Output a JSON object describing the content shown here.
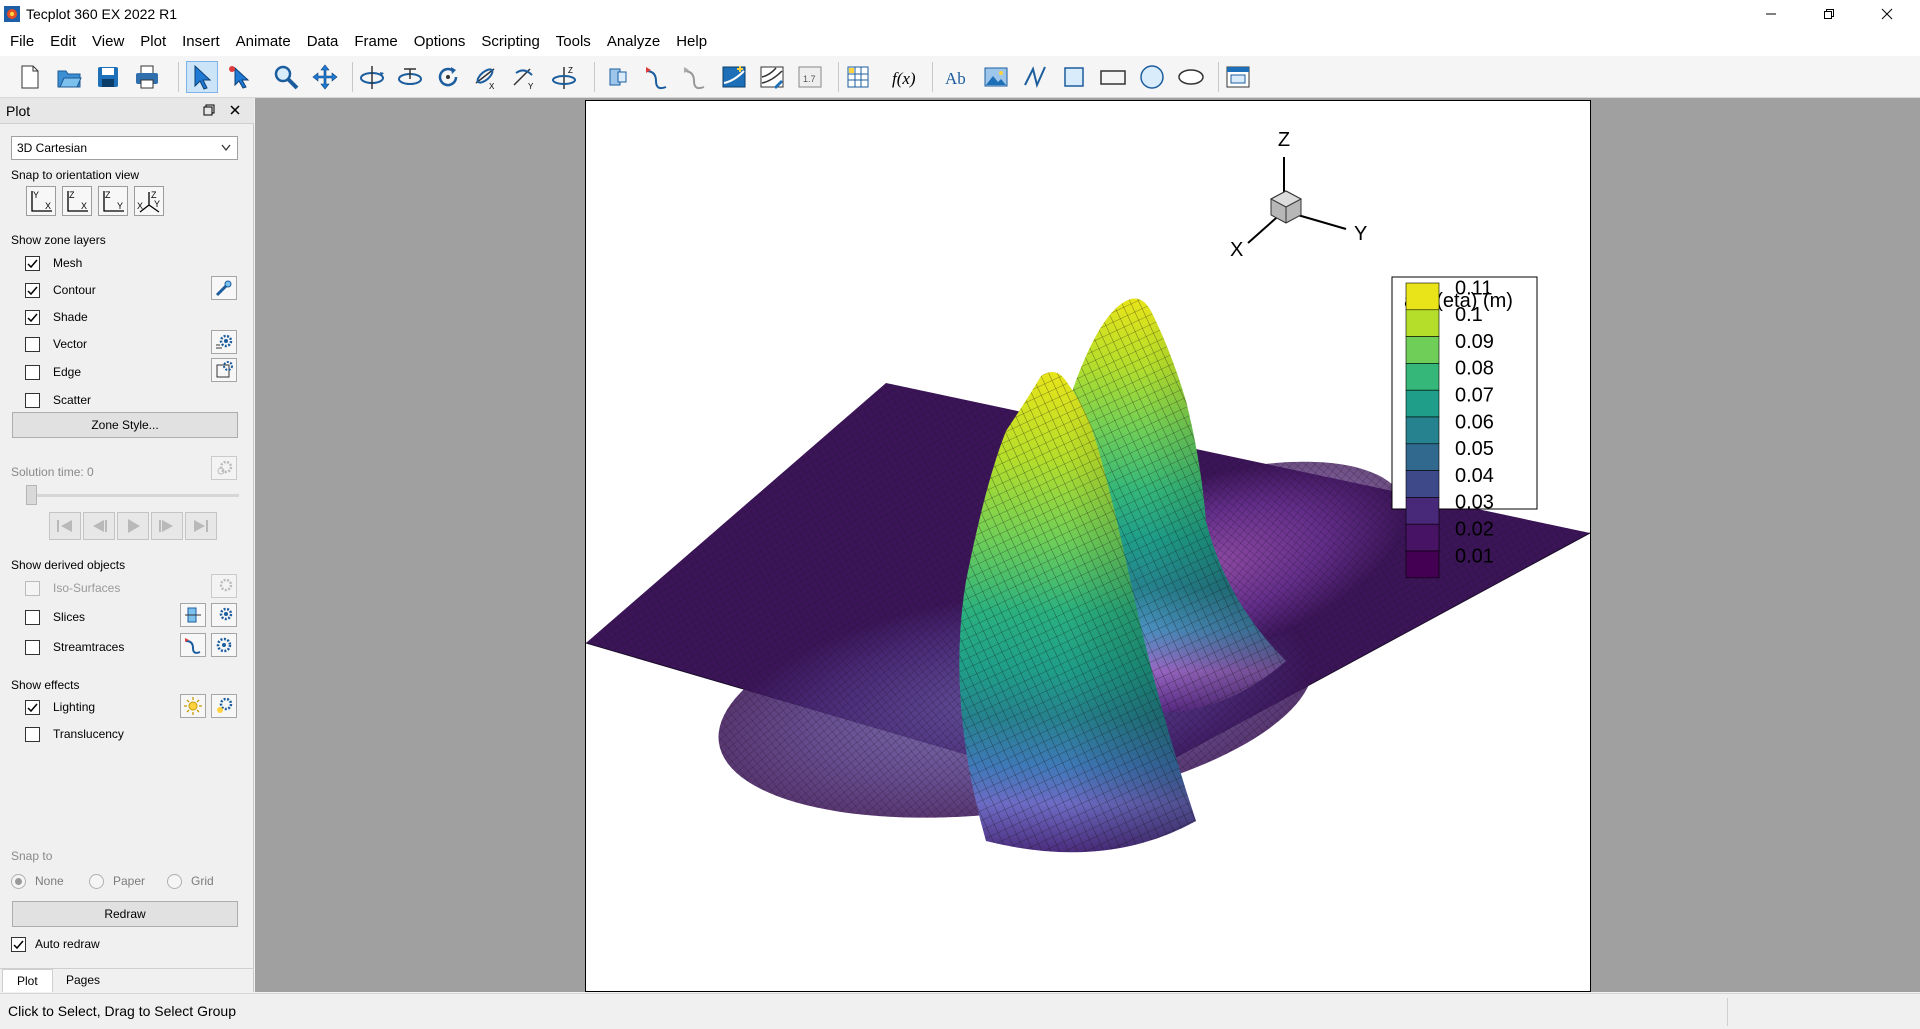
{
  "window": {
    "title": "Tecplot 360 EX 2022 R1"
  },
  "menu": [
    "File",
    "Edit",
    "View",
    "Plot",
    "Insert",
    "Animate",
    "Data",
    "Frame",
    "Options",
    "Scripting",
    "Tools",
    "Analyze",
    "Help"
  ],
  "panel": {
    "title": "Plot",
    "plot_type": "3D Cartesian",
    "snap_orientation_label": "Snap to orientation view",
    "zone_layers_label": "Show zone layers",
    "layers": [
      {
        "label": "Mesh",
        "checked": true
      },
      {
        "label": "Contour",
        "checked": true
      },
      {
        "label": "Shade",
        "checked": true
      },
      {
        "label": "Vector",
        "checked": false
      },
      {
        "label": "Edge",
        "checked": false
      },
      {
        "label": "Scatter",
        "checked": false
      }
    ],
    "zone_style_button": "Zone Style...",
    "solution_time": "Solution time: 0",
    "derived_label": "Show derived objects",
    "derived": [
      {
        "label": "Iso-Surfaces",
        "checked": false,
        "disabled": true
      },
      {
        "label": "Slices",
        "checked": false,
        "disabled": false
      },
      {
        "label": "Streamtraces",
        "checked": false,
        "disabled": false
      }
    ],
    "effects_label": "Show effects",
    "effects": [
      {
        "label": "Lighting",
        "checked": true
      },
      {
        "label": "Translucency",
        "checked": false
      }
    ],
    "snap_to_label": "Snap to",
    "snap_options": [
      "None",
      "Paper",
      "Grid"
    ],
    "redraw_button": "Redraw",
    "auto_redraw_label": "Auto redraw",
    "auto_redraw_checked": true,
    "tabs": [
      "Plot",
      "Pages"
    ]
  },
  "plot": {
    "axis_labels": {
      "x": "X",
      "y": "Y",
      "z": "Z"
    },
    "legend": {
      "title": "abs(eta) (m)",
      "levels": [
        "0.11",
        "0.1",
        "0.09",
        "0.08",
        "0.07",
        "0.06",
        "0.05",
        "0.04",
        "0.03",
        "0.02",
        "0.01"
      ],
      "colors": [
        "#e8e419",
        "#b5de2b",
        "#6ece58",
        "#35b779",
        "#1f9e89",
        "#26828e",
        "#31688e",
        "#3e4989",
        "#482878",
        "#471365",
        "#440154"
      ]
    }
  },
  "status": {
    "text": "Click to Select, Drag to Select Group"
  }
}
